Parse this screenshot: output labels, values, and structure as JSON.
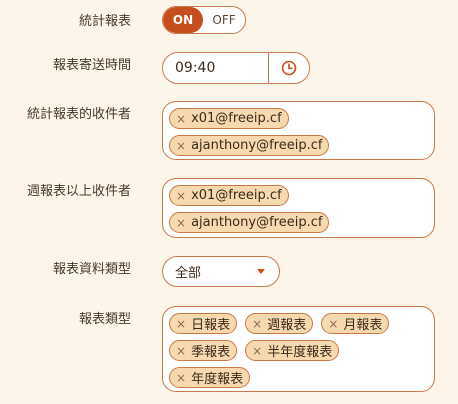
{
  "stats_report": {
    "label": "統計報表",
    "on_label": "ON",
    "off_label": "OFF"
  },
  "send_time": {
    "label": "報表寄送時間",
    "value": "09:40",
    "icon": "clock-icon"
  },
  "stats_recipients": {
    "label": "統計報表的收件者",
    "tags": [
      "x01@freeip.cf",
      "ajanthony@freeip.cf"
    ]
  },
  "weekly_recipients": {
    "label": "週報表以上收件者",
    "tags": [
      "x01@freeip.cf",
      "ajanthony@freeip.cf"
    ]
  },
  "data_type": {
    "label": "報表資料類型",
    "selected": "全部"
  },
  "report_types": {
    "label": "報表類型",
    "tags": [
      "日報表",
      "週報表",
      "月報表",
      "季報表",
      "半年度報表",
      "年度報表"
    ]
  },
  "remove_glyph": "×",
  "colors": {
    "accent": "#c44e1d",
    "border": "#c9784a",
    "tag_bg": "#f7d9b0",
    "page_bg": "#fdf5ea"
  }
}
